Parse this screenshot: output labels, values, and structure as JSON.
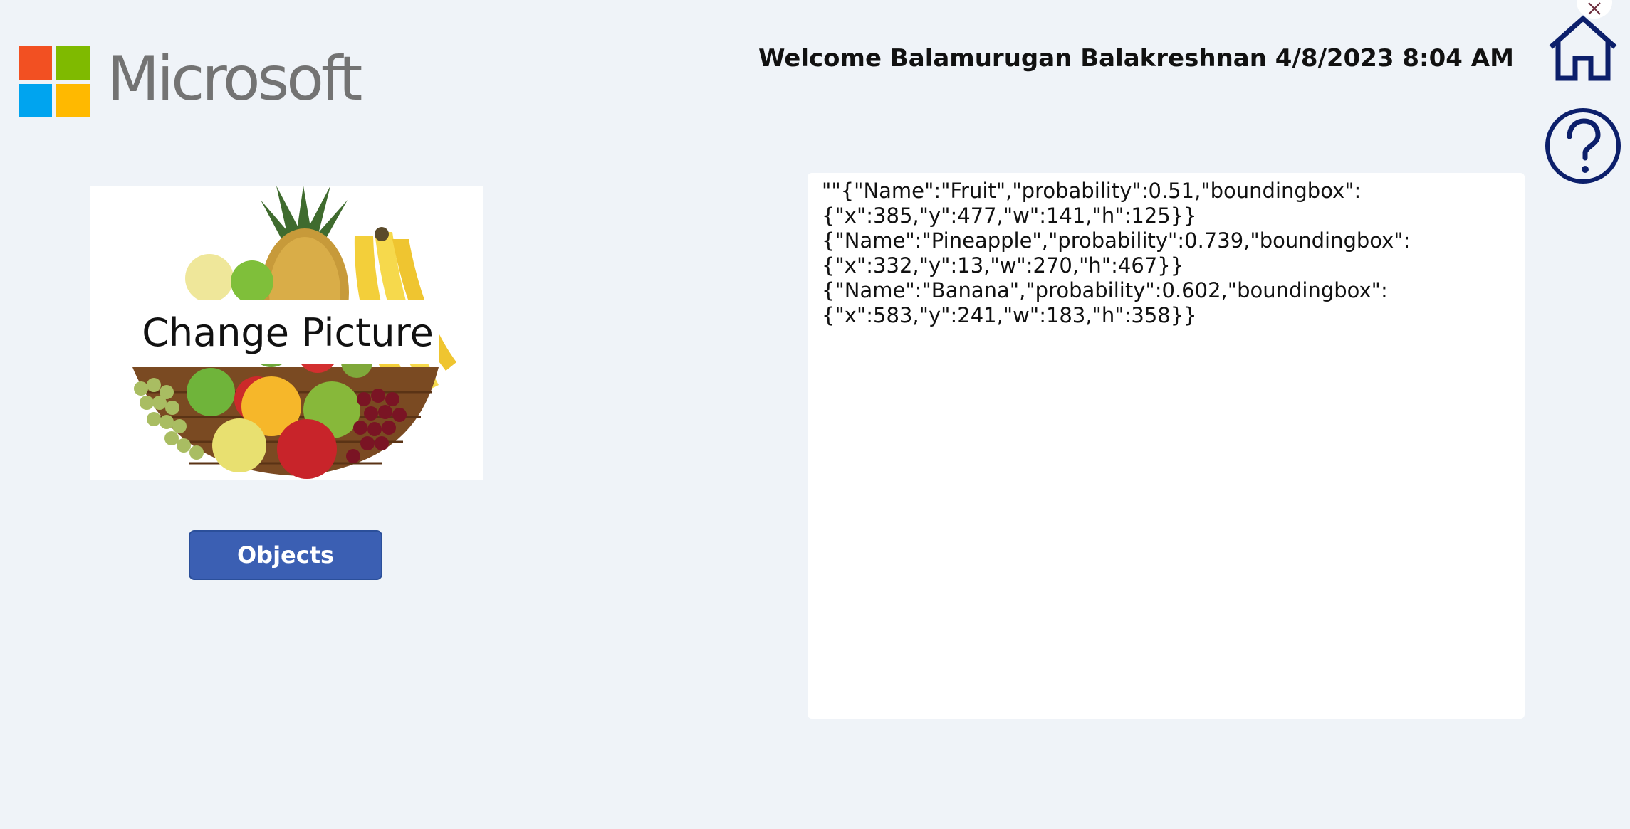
{
  "logo": {
    "text": "Microsoft",
    "colors": {
      "red": "#f25022",
      "green": "#7fba00",
      "blue": "#00a4ef",
      "yellow": "#ffb900"
    }
  },
  "header": {
    "welcome": "Welcome Balamurugan Balakreshnan 4/8/2023 8:04 AM"
  },
  "icons": {
    "close": "close-icon",
    "home": "home-icon",
    "help": "help-icon"
  },
  "picture": {
    "change_label": "Change Picture"
  },
  "objects_button": {
    "label": "Objects"
  },
  "result": {
    "lines": [
      "\"\"{\"Name\":\"Fruit\",\"probability\":0.51,\"boundingbox\":",
      "{\"x\":385,\"y\":477,\"w\":141,\"h\":125}}",
      "{\"Name\":\"Pineapple\",\"probability\":0.739,\"boundingbox\":",
      "{\"x\":332,\"y\":13,\"w\":270,\"h\":467}}",
      "{\"Name\":\"Banana\",\"probability\":0.602,\"boundingbox\":",
      "{\"x\":583,\"y\":241,\"w\":183,\"h\":358}}"
    ]
  },
  "theme": {
    "background": "#eff3f8",
    "accent": "#3b5fb3",
    "icon_color": "#0c1f6b"
  }
}
